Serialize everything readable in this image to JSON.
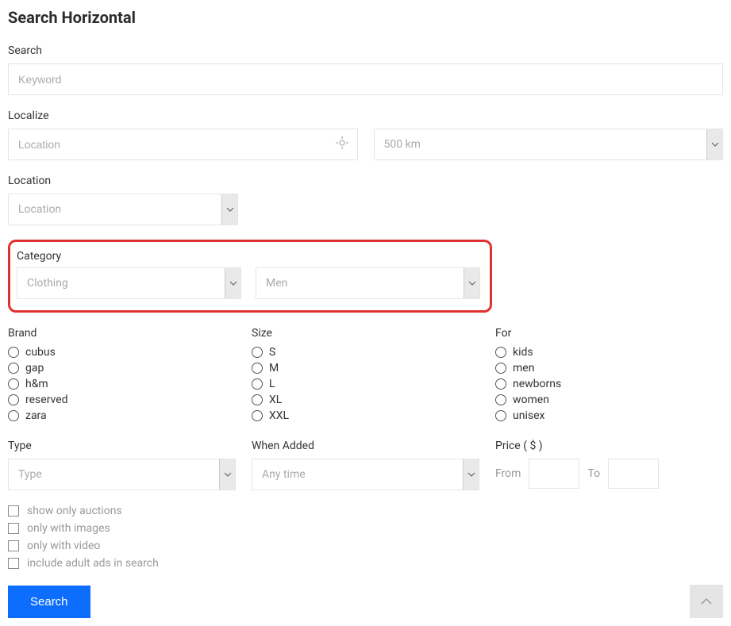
{
  "title": "Search Horizontal",
  "search": {
    "label": "Search",
    "placeholder": "Keyword"
  },
  "localize": {
    "label": "Localize",
    "location_placeholder": "Location",
    "distance_value": "500 km"
  },
  "location": {
    "label": "Location",
    "value": "Location"
  },
  "category": {
    "label": "Category",
    "main_value": "Clothing",
    "sub_value": "Men"
  },
  "brand": {
    "label": "Brand",
    "options": [
      "cubus",
      "gap",
      "h&m",
      "reserved",
      "zara"
    ]
  },
  "size": {
    "label": "Size",
    "options": [
      "S",
      "M",
      "L",
      "XL",
      "XXL"
    ]
  },
  "for": {
    "label": "For",
    "options": [
      "kids",
      "men",
      "newborns",
      "women",
      "unisex"
    ]
  },
  "type": {
    "label": "Type",
    "value": "Type"
  },
  "when_added": {
    "label": "When Added",
    "value": "Any time"
  },
  "price": {
    "label": "Price ( $ )",
    "from_label": "From",
    "to_label": "To"
  },
  "filters": {
    "auctions": "show only auctions",
    "images": "only with images",
    "video": "only with video",
    "adult": "include adult ads in search"
  },
  "search_button": "Search"
}
